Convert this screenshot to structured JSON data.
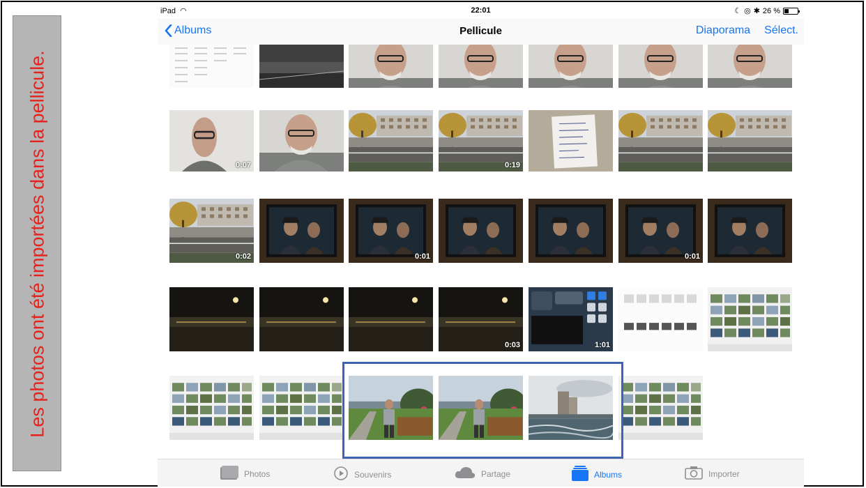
{
  "side_label": "Les photos ont été importées dans la pellicule.",
  "status": {
    "device": "iPad",
    "time": "22:01",
    "battery": "26 %"
  },
  "navbar": {
    "back_label": "Albums",
    "title": "Pellicule",
    "slideshow_label": "Diaporama",
    "select_label": "Sélect."
  },
  "thumbnails": [
    {
      "kind": "doc-screen",
      "duration": ""
    },
    {
      "kind": "street-dark",
      "duration": ""
    },
    {
      "kind": "selfie",
      "duration": ""
    },
    {
      "kind": "selfie",
      "duration": ""
    },
    {
      "kind": "selfie",
      "duration": ""
    },
    {
      "kind": "selfie",
      "duration": ""
    },
    {
      "kind": "selfie",
      "duration": ""
    },
    {
      "kind": "selfie-video",
      "duration": "0:07"
    },
    {
      "kind": "selfie",
      "duration": ""
    },
    {
      "kind": "street-autumn",
      "duration": ""
    },
    {
      "kind": "street-autumn",
      "duration": "0:19"
    },
    {
      "kind": "paper-note",
      "duration": ""
    },
    {
      "kind": "street-autumn",
      "duration": ""
    },
    {
      "kind": "street-autumn",
      "duration": ""
    },
    {
      "kind": "street-autumn",
      "duration": "0:02"
    },
    {
      "kind": "movie-tv",
      "duration": ""
    },
    {
      "kind": "movie-tv",
      "duration": "0:01"
    },
    {
      "kind": "movie-tv",
      "duration": ""
    },
    {
      "kind": "movie-tv",
      "duration": ""
    },
    {
      "kind": "movie-tv",
      "duration": "0:01"
    },
    {
      "kind": "movie-tv",
      "duration": ""
    },
    {
      "kind": "night-street",
      "duration": ""
    },
    {
      "kind": "night-street",
      "duration": ""
    },
    {
      "kind": "night-street",
      "duration": ""
    },
    {
      "kind": "night-street",
      "duration": "0:03"
    },
    {
      "kind": "control-center",
      "duration": "1:01"
    },
    {
      "kind": "photos-app-screen",
      "duration": ""
    },
    {
      "kind": "photo-grid-screen",
      "duration": ""
    },
    {
      "kind": "photo-grid-screen",
      "duration": ""
    },
    {
      "kind": "photo-grid-screen",
      "duration": ""
    },
    {
      "kind": "harbor-man",
      "duration": ""
    },
    {
      "kind": "harbor-man",
      "duration": ""
    },
    {
      "kind": "harbor-tower",
      "duration": ""
    },
    {
      "kind": "photo-grid-screen",
      "duration": ""
    }
  ],
  "tabs": [
    {
      "label": "Photos",
      "icon": "photos-icon",
      "active": false
    },
    {
      "label": "Souvenirs",
      "icon": "memories-icon",
      "active": false
    },
    {
      "label": "Partage",
      "icon": "cloud-icon",
      "active": false
    },
    {
      "label": "Albums",
      "icon": "albums-icon",
      "active": true
    },
    {
      "label": "Importer",
      "icon": "camera-icon",
      "active": false
    }
  ],
  "colors": {
    "accent": "#1676f3",
    "side_text": "#e8211d",
    "highlight_border": "#3c64b1"
  }
}
